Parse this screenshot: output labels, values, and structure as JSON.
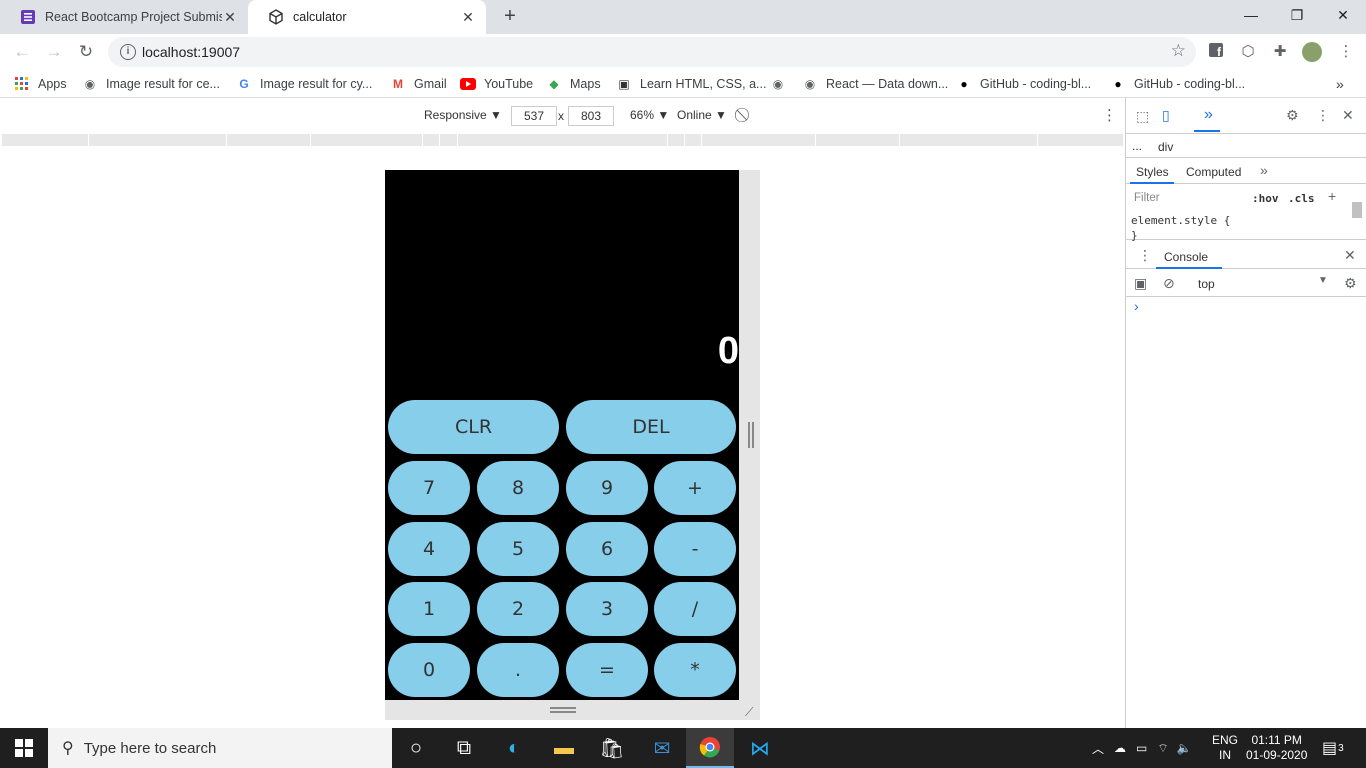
{
  "tabs": [
    {
      "title": "React Bootcamp Project Submiss",
      "icon": "forms-icon"
    },
    {
      "title": "calculator",
      "icon": "react-cube-icon"
    }
  ],
  "address": {
    "url": "localhost:19007"
  },
  "bookmarks": [
    "Apps",
    "Image result for ce...",
    "Image result for cy...",
    "Gmail",
    "YouTube",
    "Maps",
    "Learn HTML, CSS, a...",
    "React — Data down...",
    "GitHub - coding-bl...",
    "GitHub - coding-bl..."
  ],
  "device_toolbar": {
    "mode": "Responsive",
    "width": "537",
    "times": "x",
    "height": "803",
    "zoom": "66%",
    "network": "Online"
  },
  "calculator": {
    "display": "0",
    "buttons": [
      "CLR",
      "DEL",
      "7",
      "8",
      "9",
      "+",
      "4",
      "5",
      "6",
      "-",
      "1",
      "2",
      "3",
      "/",
      "0",
      ".",
      "=",
      "*"
    ]
  },
  "devtools": {
    "breadcrumb_dots": "...",
    "breadcrumb": "div",
    "tabs": [
      "Styles",
      "Computed"
    ],
    "filter_placeholder": "Filter",
    "hov": ":hov",
    "cls": ".cls",
    "element_style": "element.style {",
    "close_brace": "}",
    "console_title": "Console",
    "context": "top",
    "prompt": "›"
  },
  "taskbar": {
    "search_placeholder": "Type here to search",
    "lang1": "ENG",
    "lang2": "IN",
    "time": "01:11 PM",
    "date": "01-09-2020",
    "notifications": "3"
  },
  "colors": {
    "button": "#87ceeb",
    "calc_bg": "#000000",
    "accent": "#1a73e8"
  }
}
